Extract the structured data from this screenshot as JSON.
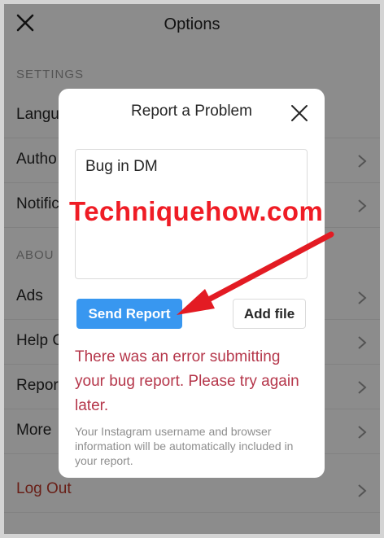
{
  "background": {
    "title": "Options",
    "sections": {
      "settings": "SETTINGS",
      "about": "ABOU"
    },
    "rows": [
      {
        "label": "Langu"
      },
      {
        "label": "Autho"
      },
      {
        "label": "Notific"
      },
      {
        "label": "Ads"
      },
      {
        "label": "Help C"
      },
      {
        "label": "Repor"
      },
      {
        "label": "More"
      }
    ],
    "logout": "Log Out"
  },
  "modal": {
    "title": "Report a Problem",
    "textarea_value": "Bug in DM",
    "send_label": "Send Report",
    "add_file_label": "Add file",
    "error_text": "There was an error submitting your bug report. Please try again later.",
    "note_text": "Your Instagram username and browser information will be automatically included in your report."
  },
  "watermark": "Techniquehow.com",
  "colors": {
    "accent": "#3897f0",
    "error": "#b5364a",
    "watermark": "#ef1c25",
    "logout": "#c0392b"
  }
}
